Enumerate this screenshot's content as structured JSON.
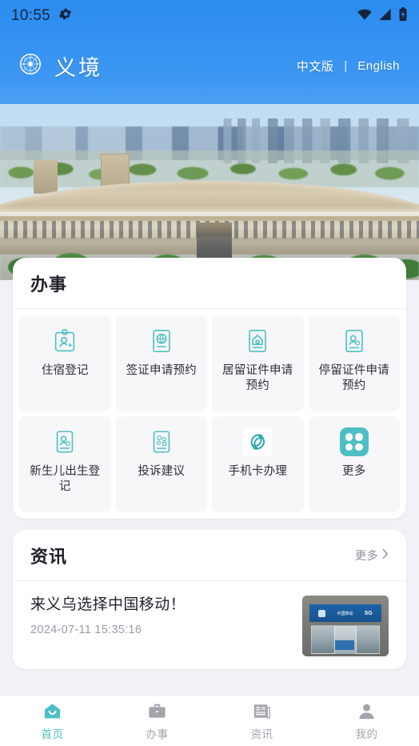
{
  "status_bar": {
    "time": "10:55",
    "icons": [
      "gear-icon",
      "wifi-icon",
      "cellular-signal-icon",
      "battery-charging-icon"
    ]
  },
  "header": {
    "logo": "yijing-emblem-logo",
    "app_name": "义境",
    "language": {
      "chinese_label": "中文版",
      "separator": "|",
      "english_label": "English"
    }
  },
  "hero": {
    "alt": "aerial-view-yiwu-international-trade-city"
  },
  "services": {
    "title": "办事",
    "items": [
      {
        "label": "住宿登记",
        "icon": "id-card-person-add-icon"
      },
      {
        "label": "签证申请预约",
        "icon": "passport-globe-icon"
      },
      {
        "label": "居留证件申请预约",
        "icon": "document-house-icon"
      },
      {
        "label": "停留证件申请预约",
        "icon": "document-person-stay-icon"
      },
      {
        "label": "新生儿出生登记",
        "icon": "document-newborn-icon"
      },
      {
        "label": "投诉建议",
        "icon": "document-feedback-icon"
      },
      {
        "label": "手机卡办理",
        "icon": "china-mobile-logo-icon"
      },
      {
        "label": "更多",
        "icon": "more-grid-icon"
      }
    ]
  },
  "news": {
    "title": "资讯",
    "more_label": "更多",
    "more_chevron": "chevron-right-icon",
    "items": [
      {
        "title": "来义乌选择中国移动！",
        "date": "2024-07-11 15:35:16",
        "thumb_alt": "china-mobile-store-front",
        "thumb_band_brand": "中国移动",
        "thumb_band_tag": "5G"
      }
    ]
  },
  "tabbar": {
    "active_index": 0,
    "items": [
      {
        "label": "首页",
        "icon": "home-icon"
      },
      {
        "label": "办事",
        "icon": "briefcase-icon"
      },
      {
        "label": "资讯",
        "icon": "newspaper-icon"
      },
      {
        "label": "我的",
        "icon": "user-profile-icon"
      }
    ]
  },
  "colors": {
    "accent_teal": "#4cbfc4",
    "header_blue": "#2a8cf0",
    "page_bg": "#f1f1f6",
    "card_bg": "#ffffff",
    "tile_bg": "#f7f7f9",
    "title_text": "#20232b",
    "muted_text": "#9a9ca6"
  }
}
